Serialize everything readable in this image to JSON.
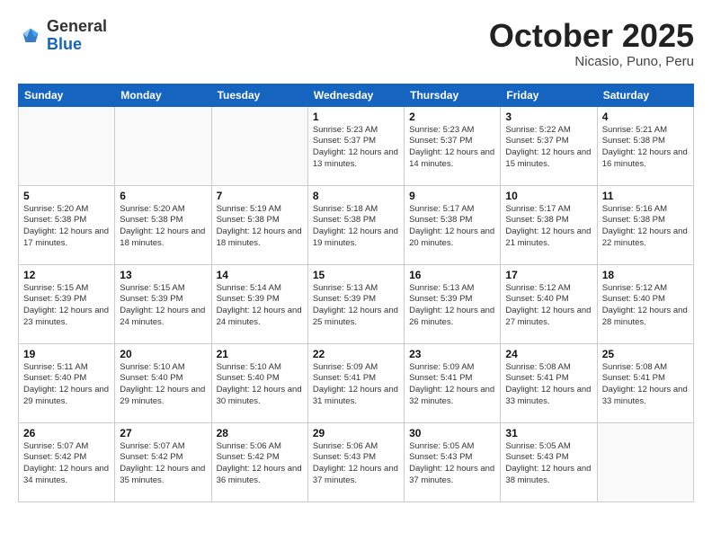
{
  "logo": {
    "general": "General",
    "blue": "Blue"
  },
  "header": {
    "month": "October 2025",
    "location": "Nicasio, Puno, Peru"
  },
  "weekdays": [
    "Sunday",
    "Monday",
    "Tuesday",
    "Wednesday",
    "Thursday",
    "Friday",
    "Saturday"
  ],
  "weeks": [
    [
      {
        "day": "",
        "sunrise": "",
        "sunset": "",
        "daylight": ""
      },
      {
        "day": "",
        "sunrise": "",
        "sunset": "",
        "daylight": ""
      },
      {
        "day": "",
        "sunrise": "",
        "sunset": "",
        "daylight": ""
      },
      {
        "day": "1",
        "sunrise": "Sunrise: 5:23 AM",
        "sunset": "Sunset: 5:37 PM",
        "daylight": "Daylight: 12 hours and 13 minutes."
      },
      {
        "day": "2",
        "sunrise": "Sunrise: 5:23 AM",
        "sunset": "Sunset: 5:37 PM",
        "daylight": "Daylight: 12 hours and 14 minutes."
      },
      {
        "day": "3",
        "sunrise": "Sunrise: 5:22 AM",
        "sunset": "Sunset: 5:37 PM",
        "daylight": "Daylight: 12 hours and 15 minutes."
      },
      {
        "day": "4",
        "sunrise": "Sunrise: 5:21 AM",
        "sunset": "Sunset: 5:38 PM",
        "daylight": "Daylight: 12 hours and 16 minutes."
      }
    ],
    [
      {
        "day": "5",
        "sunrise": "Sunrise: 5:20 AM",
        "sunset": "Sunset: 5:38 PM",
        "daylight": "Daylight: 12 hours and 17 minutes."
      },
      {
        "day": "6",
        "sunrise": "Sunrise: 5:20 AM",
        "sunset": "Sunset: 5:38 PM",
        "daylight": "Daylight: 12 hours and 18 minutes."
      },
      {
        "day": "7",
        "sunrise": "Sunrise: 5:19 AM",
        "sunset": "Sunset: 5:38 PM",
        "daylight": "Daylight: 12 hours and 18 minutes."
      },
      {
        "day": "8",
        "sunrise": "Sunrise: 5:18 AM",
        "sunset": "Sunset: 5:38 PM",
        "daylight": "Daylight: 12 hours and 19 minutes."
      },
      {
        "day": "9",
        "sunrise": "Sunrise: 5:17 AM",
        "sunset": "Sunset: 5:38 PM",
        "daylight": "Daylight: 12 hours and 20 minutes."
      },
      {
        "day": "10",
        "sunrise": "Sunrise: 5:17 AM",
        "sunset": "Sunset: 5:38 PM",
        "daylight": "Daylight: 12 hours and 21 minutes."
      },
      {
        "day": "11",
        "sunrise": "Sunrise: 5:16 AM",
        "sunset": "Sunset: 5:38 PM",
        "daylight": "Daylight: 12 hours and 22 minutes."
      }
    ],
    [
      {
        "day": "12",
        "sunrise": "Sunrise: 5:15 AM",
        "sunset": "Sunset: 5:39 PM",
        "daylight": "Daylight: 12 hours and 23 minutes."
      },
      {
        "day": "13",
        "sunrise": "Sunrise: 5:15 AM",
        "sunset": "Sunset: 5:39 PM",
        "daylight": "Daylight: 12 hours and 24 minutes."
      },
      {
        "day": "14",
        "sunrise": "Sunrise: 5:14 AM",
        "sunset": "Sunset: 5:39 PM",
        "daylight": "Daylight: 12 hours and 24 minutes."
      },
      {
        "day": "15",
        "sunrise": "Sunrise: 5:13 AM",
        "sunset": "Sunset: 5:39 PM",
        "daylight": "Daylight: 12 hours and 25 minutes."
      },
      {
        "day": "16",
        "sunrise": "Sunrise: 5:13 AM",
        "sunset": "Sunset: 5:39 PM",
        "daylight": "Daylight: 12 hours and 26 minutes."
      },
      {
        "day": "17",
        "sunrise": "Sunrise: 5:12 AM",
        "sunset": "Sunset: 5:40 PM",
        "daylight": "Daylight: 12 hours and 27 minutes."
      },
      {
        "day": "18",
        "sunrise": "Sunrise: 5:12 AM",
        "sunset": "Sunset: 5:40 PM",
        "daylight": "Daylight: 12 hours and 28 minutes."
      }
    ],
    [
      {
        "day": "19",
        "sunrise": "Sunrise: 5:11 AM",
        "sunset": "Sunset: 5:40 PM",
        "daylight": "Daylight: 12 hours and 29 minutes."
      },
      {
        "day": "20",
        "sunrise": "Sunrise: 5:10 AM",
        "sunset": "Sunset: 5:40 PM",
        "daylight": "Daylight: 12 hours and 29 minutes."
      },
      {
        "day": "21",
        "sunrise": "Sunrise: 5:10 AM",
        "sunset": "Sunset: 5:40 PM",
        "daylight": "Daylight: 12 hours and 30 minutes."
      },
      {
        "day": "22",
        "sunrise": "Sunrise: 5:09 AM",
        "sunset": "Sunset: 5:41 PM",
        "daylight": "Daylight: 12 hours and 31 minutes."
      },
      {
        "day": "23",
        "sunrise": "Sunrise: 5:09 AM",
        "sunset": "Sunset: 5:41 PM",
        "daylight": "Daylight: 12 hours and 32 minutes."
      },
      {
        "day": "24",
        "sunrise": "Sunrise: 5:08 AM",
        "sunset": "Sunset: 5:41 PM",
        "daylight": "Daylight: 12 hours and 33 minutes."
      },
      {
        "day": "25",
        "sunrise": "Sunrise: 5:08 AM",
        "sunset": "Sunset: 5:41 PM",
        "daylight": "Daylight: 12 hours and 33 minutes."
      }
    ],
    [
      {
        "day": "26",
        "sunrise": "Sunrise: 5:07 AM",
        "sunset": "Sunset: 5:42 PM",
        "daylight": "Daylight: 12 hours and 34 minutes."
      },
      {
        "day": "27",
        "sunrise": "Sunrise: 5:07 AM",
        "sunset": "Sunset: 5:42 PM",
        "daylight": "Daylight: 12 hours and 35 minutes."
      },
      {
        "day": "28",
        "sunrise": "Sunrise: 5:06 AM",
        "sunset": "Sunset: 5:42 PM",
        "daylight": "Daylight: 12 hours and 36 minutes."
      },
      {
        "day": "29",
        "sunrise": "Sunrise: 5:06 AM",
        "sunset": "Sunset: 5:43 PM",
        "daylight": "Daylight: 12 hours and 37 minutes."
      },
      {
        "day": "30",
        "sunrise": "Sunrise: 5:05 AM",
        "sunset": "Sunset: 5:43 PM",
        "daylight": "Daylight: 12 hours and 37 minutes."
      },
      {
        "day": "31",
        "sunrise": "Sunrise: 5:05 AM",
        "sunset": "Sunset: 5:43 PM",
        "daylight": "Daylight: 12 hours and 38 minutes."
      },
      {
        "day": "",
        "sunrise": "",
        "sunset": "",
        "daylight": ""
      }
    ]
  ]
}
